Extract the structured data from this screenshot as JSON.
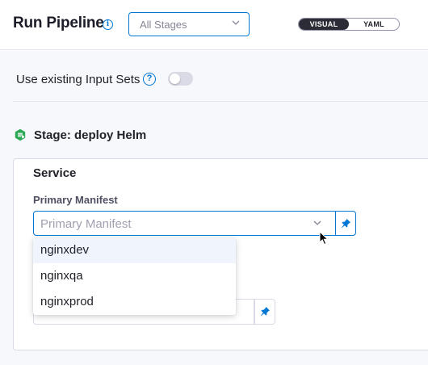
{
  "header": {
    "title": "Run Pipeline",
    "stage_select_value": "All Stages",
    "view_toggle": {
      "visual_label": "VISUAL",
      "yaml_label": "YAML",
      "selected": "VISUAL"
    }
  },
  "input_sets": {
    "label": "Use existing Input Sets",
    "help_glyph": "?",
    "enabled": false
  },
  "stage": {
    "label": "Stage: deploy Helm",
    "icon": "helm-deploy-stage-icon",
    "icon_color": "#2aa853"
  },
  "service": {
    "section_label": "Service",
    "primary_manifest": {
      "label": "Primary Manifest",
      "placeholder": "Primary Manifest",
      "options": [
        "nginxdev",
        "nginxqa",
        "nginxprod"
      ],
      "highlighted_option": "nginxdev"
    }
  },
  "colors": {
    "accent": "#0278d5",
    "toggle_active_bg": "#2b2c35",
    "dropdown_hover_bg": "#f0f5fd"
  }
}
